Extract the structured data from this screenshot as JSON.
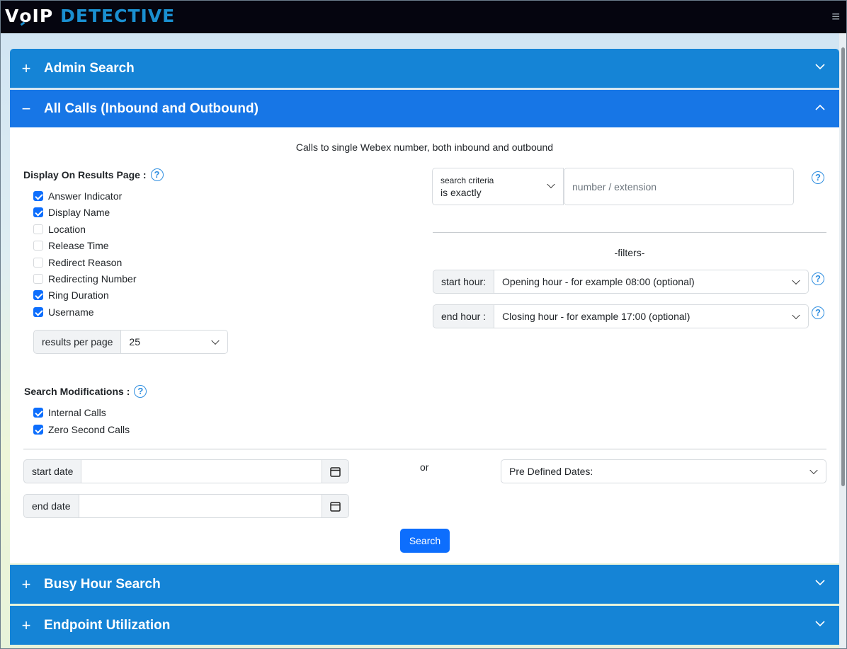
{
  "header": {
    "logo_v": "V",
    "logo_o": "o",
    "logo_ip": "IP",
    "logo_detective": "DETECTIVE",
    "menu_icon": "≡"
  },
  "accordion": {
    "admin_search": {
      "sign": "+",
      "title": "Admin Search"
    },
    "all_calls": {
      "sign": "−",
      "title": "All Calls (Inbound and Outbound)"
    },
    "busy_hour": {
      "sign": "+",
      "title": "Busy Hour Search"
    },
    "endpoint": {
      "sign": "+",
      "title": "Endpoint Utilization"
    }
  },
  "panel": {
    "subtitle": "Calls to single Webex number, both inbound and outbound",
    "display_label": "Display On Results Page :",
    "display_options": [
      {
        "label": "Answer Indicator",
        "checked": true
      },
      {
        "label": "Display Name",
        "checked": true
      },
      {
        "label": "Location",
        "checked": false
      },
      {
        "label": "Release Time",
        "checked": false
      },
      {
        "label": "Redirect Reason",
        "checked": false
      },
      {
        "label": "Redirecting Number",
        "checked": false
      },
      {
        "label": "Ring Duration",
        "checked": true
      },
      {
        "label": "Username",
        "checked": true
      }
    ],
    "results_per_page_label": "results per page",
    "results_per_page_value": "25",
    "modifications_label": "Search Modifications :",
    "modifications": [
      {
        "label": "Internal Calls",
        "checked": true
      },
      {
        "label": "Zero Second Calls",
        "checked": true
      }
    ],
    "criteria_label": "search criteria",
    "criteria_value": "is exactly",
    "number_placeholder": "number / extension",
    "filters_label": "-filters-",
    "start_hour_label": "start hour:",
    "start_hour_value": "Opening hour - for example 08:00 (optional)",
    "end_hour_label": "end hour :",
    "end_hour_value": "Closing hour - for example 17:00 (optional)",
    "start_date_label": "start date",
    "end_date_label": "end date",
    "or_label": "or",
    "predefined_value": "Pre Defined Dates:",
    "search_button": "Search",
    "help_glyph": "?"
  },
  "colors": {
    "accordion": "#1584d6",
    "accordion_active": "#1776e6",
    "primary": "#0d6efd",
    "logo_blue": "#1a8fd0"
  }
}
